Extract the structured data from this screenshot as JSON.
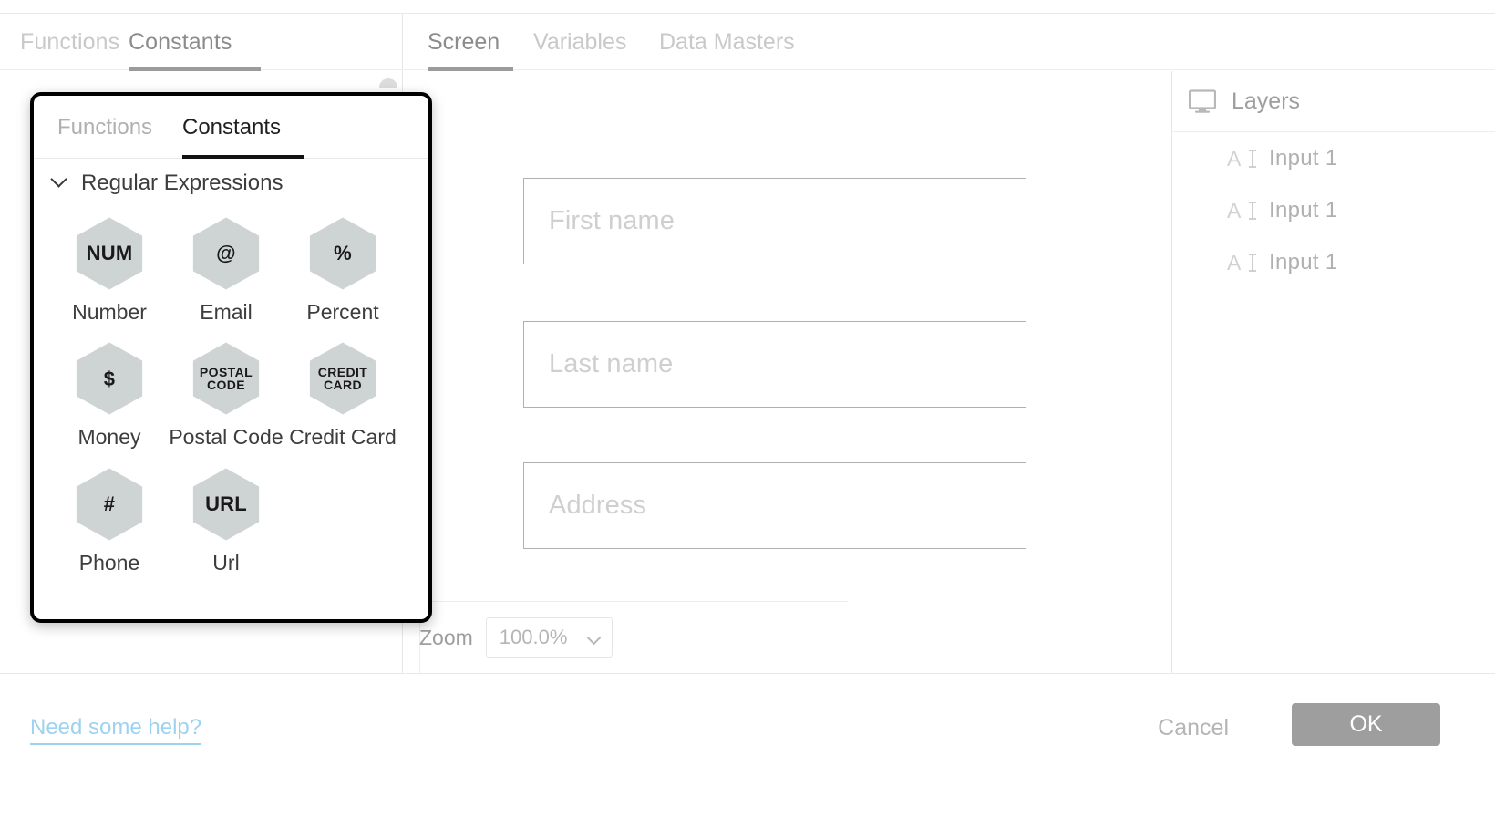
{
  "left_panel": {
    "tabs": [
      {
        "label": "Functions",
        "active": false
      },
      {
        "label": "Constants",
        "active": true
      }
    ]
  },
  "editor": {
    "tabs": [
      {
        "label": "Screen",
        "active": true
      },
      {
        "label": "Variables",
        "active": false
      },
      {
        "label": "Data Masters",
        "active": false
      }
    ],
    "canvas": {
      "fields": [
        {
          "placeholder": "First name"
        },
        {
          "placeholder": "Last name"
        },
        {
          "placeholder": "Address"
        }
      ]
    },
    "zoom": {
      "label": "Zoom",
      "value": "100.0%",
      "chevron_icon": "chevron-down-icon"
    }
  },
  "layers": {
    "title": "Layers",
    "icon": "monitor-icon",
    "items": [
      {
        "icon": "text-input-icon",
        "label": "Input 1"
      },
      {
        "icon": "text-input-icon",
        "label": "Input 1"
      },
      {
        "icon": "text-input-icon",
        "label": "Input 1"
      }
    ]
  },
  "popup": {
    "tabs": [
      {
        "label": "Functions",
        "active": false
      },
      {
        "label": "Constants",
        "active": true
      }
    ],
    "group": {
      "title": "Regular Expressions",
      "expanded": true,
      "caret_icon": "chevron-down-icon"
    },
    "constants": [
      {
        "glyph": "NUM",
        "glyph_size": "normal",
        "name": "Number"
      },
      {
        "glyph": "@",
        "glyph_size": "normal",
        "name": "Email"
      },
      {
        "glyph": "%",
        "glyph_size": "normal",
        "name": "Percent"
      },
      {
        "glyph": "$",
        "glyph_size": "normal",
        "name": "Money"
      },
      {
        "glyph": "POSTAL\nCODE",
        "glyph_size": "small",
        "name": "Postal Code"
      },
      {
        "glyph": "CREDIT\nCARD",
        "glyph_size": "small",
        "name": "Credit Card"
      },
      {
        "glyph": "#",
        "glyph_size": "normal",
        "name": "Phone"
      },
      {
        "glyph": "URL",
        "glyph_size": "normal",
        "name": "Url"
      }
    ]
  },
  "footer": {
    "help_label": "Need some help?",
    "cancel_label": "Cancel",
    "ok_label": "OK"
  },
  "colors": {
    "hex_fill": "#ced3d4",
    "accent_link": "#9ed2f1",
    "ok_button": "#9e9e9e",
    "popup_border": "#000000"
  }
}
